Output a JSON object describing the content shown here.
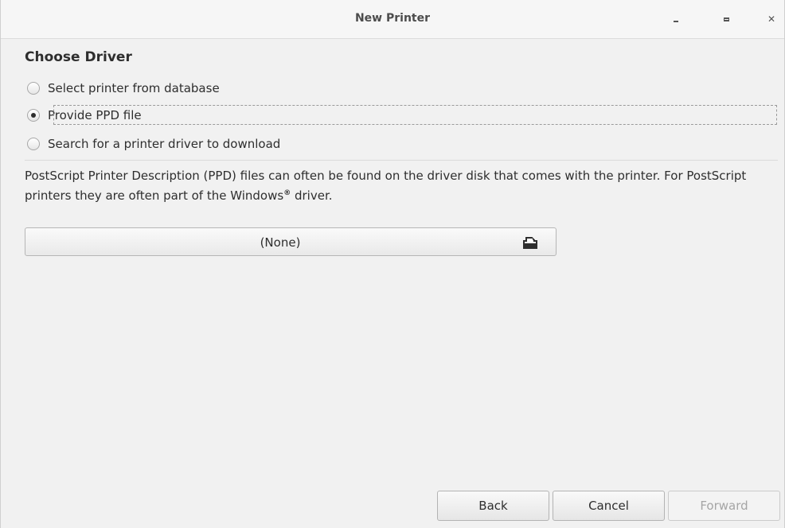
{
  "window": {
    "title": "New Printer",
    "minimize_icon": "minimize-icon",
    "maximize_icon": "maximize-icon",
    "close_icon": "close-icon"
  },
  "page": {
    "heading": "Choose Driver",
    "options": [
      {
        "label": "Select printer from database",
        "selected": false
      },
      {
        "label": "Provide PPD file",
        "selected": true
      },
      {
        "label": "Search for a printer driver to download",
        "selected": false
      }
    ],
    "description_main": "PostScript Printer Description (PPD) files can often be found on the driver disk that comes with the printer. For PostScript printers they are often part of the Windows",
    "description_mark": "®",
    "description_end": "driver.",
    "file_chooser": {
      "value": "(None)",
      "icon": "open-document-icon"
    }
  },
  "buttons": {
    "back": "Back",
    "cancel": "Cancel",
    "forward": "Forward",
    "forward_enabled": false
  },
  "colors": {
    "window_bg": "#f1f1f1",
    "titlebar_bg": "#f6f6f6",
    "text": "#2e2e2e",
    "disabled_text": "#a5a5a5"
  }
}
